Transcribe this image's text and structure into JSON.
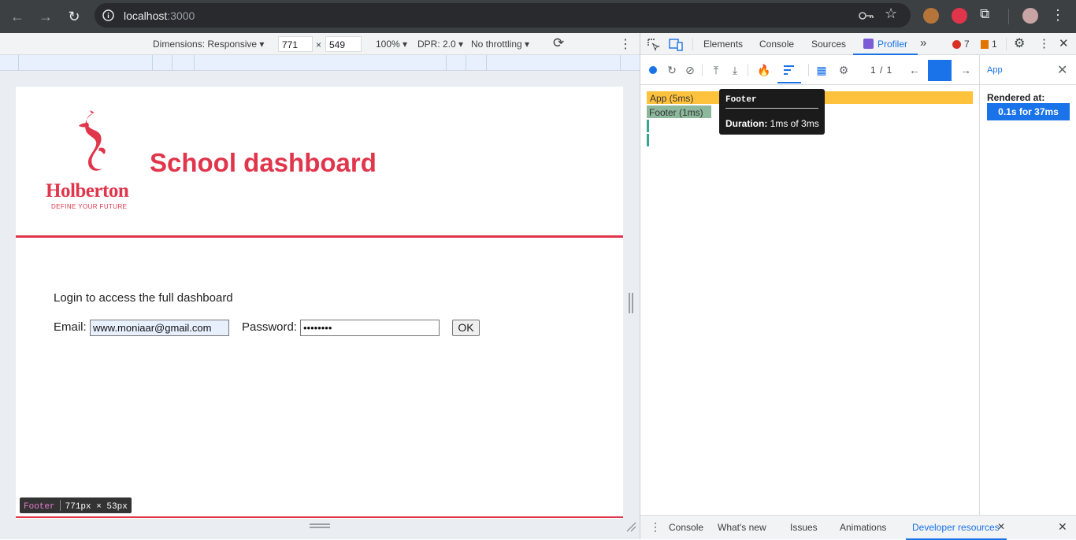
{
  "browser": {
    "url_host": "localhost",
    "url_port": ":3000"
  },
  "device_toolbar": {
    "dimensions_label": "Dimensions: Responsive",
    "width": "771",
    "times": "×",
    "height": "549",
    "zoom": "100%",
    "dpr": "DPR: 2.0",
    "throttling": "No throttling"
  },
  "page": {
    "logo_text": "Holberton",
    "logo_tagline": "DEFINE YOUR FUTURE",
    "title": "School dashboard",
    "login_message": "Login to access the full dashboard",
    "email_label": "Email:",
    "email_value": "www.moniaar@gmail.com",
    "password_label": "Password:",
    "password_value": "••••••••",
    "ok_label": "OK",
    "inspect_tip_name": "Footer",
    "inspect_tip_size": "771px × 53px"
  },
  "devtools": {
    "tabs": [
      "Elements",
      "Console",
      "Sources",
      "Profiler"
    ],
    "error_count": "7",
    "warning_count": "1",
    "commit_counter": "1 / 1",
    "flame": {
      "app_bar": "App (5ms)",
      "footer_bar": "Footer (1ms)"
    },
    "tooltip": {
      "name": "Footer",
      "duration_label": "Duration:",
      "duration_value": "1ms of 3ms"
    },
    "side_panel": {
      "component": "App",
      "rendered_at_label": "Rendered at:",
      "rendered_at_value": "0.1s for 37ms"
    },
    "drawer_tabs": [
      "Console",
      "What's new",
      "Issues",
      "Animations",
      "Developer resources"
    ]
  },
  "colors": {
    "brand_red": "#e0354b",
    "app_bar": "#ffc23d",
    "footer_bar": "#8cb89c",
    "accent_blue": "#1a73e8"
  }
}
